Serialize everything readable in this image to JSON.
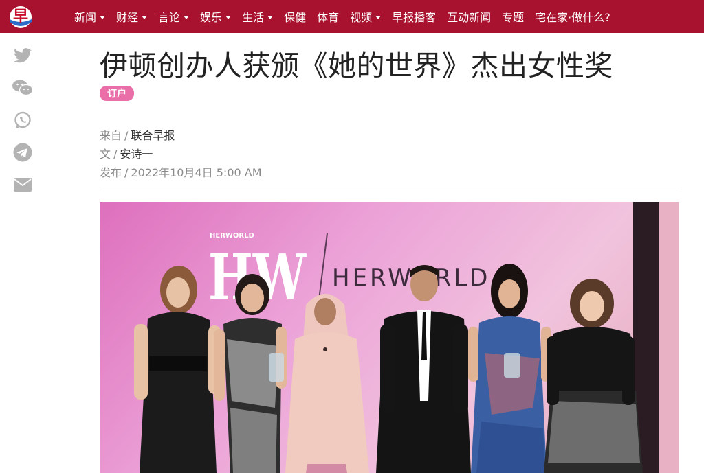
{
  "header": {
    "logo_glyph": "早",
    "brand_color": "#a8122f",
    "nav": [
      {
        "label": "新闻",
        "has_dropdown": true
      },
      {
        "label": "财经",
        "has_dropdown": true
      },
      {
        "label": "言论",
        "has_dropdown": true
      },
      {
        "label": "娱乐",
        "has_dropdown": true
      },
      {
        "label": "生活",
        "has_dropdown": true
      },
      {
        "label": "保健",
        "has_dropdown": false
      },
      {
        "label": "体育",
        "has_dropdown": false
      },
      {
        "label": "视频",
        "has_dropdown": true
      },
      {
        "label": "早报播客",
        "has_dropdown": false
      },
      {
        "label": "互动新闻",
        "has_dropdown": false
      },
      {
        "label": "专题",
        "has_dropdown": false
      },
      {
        "label": "宅在家·做什么?",
        "has_dropdown": false
      }
    ]
  },
  "share": {
    "icons": [
      "twitter-icon",
      "wechat-icon",
      "whatsapp-icon",
      "telegram-icon",
      "email-icon"
    ],
    "icon_color": "#b3b3b3"
  },
  "article": {
    "title": "伊顿创办人获颁《她的世界》杰出女性奖",
    "badge": "订户",
    "badge_color": "#ea6fa8",
    "source_label": "来自",
    "source": "联合早报",
    "author_label": "文",
    "author": "安诗一",
    "published_label": "发布",
    "published": "2022年10月4日 5:00 AM",
    "separator": "/"
  },
  "photo": {
    "brand_small": "HERWORLD",
    "logo_letters": "HW",
    "brand_large": "HERWORLD"
  }
}
